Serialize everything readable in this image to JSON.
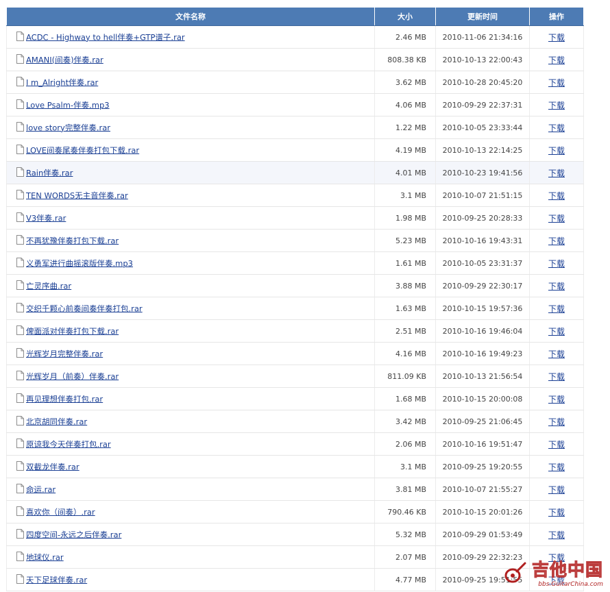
{
  "header": {
    "name": "文件名称",
    "size": "大小",
    "time": "更新时间",
    "op": "操作"
  },
  "download_label": "下载",
  "highlight_row": 6,
  "files": [
    {
      "name": "ACDC - Highway to hell伴奏+GTP谱子.rar",
      "size": "2.46 MB",
      "time": "2010-11-06 21:34:16"
    },
    {
      "name": "AMANI(间奏)伴奏.rar",
      "size": "808.38 KB",
      "time": "2010-10-13 22:00:43"
    },
    {
      "name": "I m_Alright伴奏.rar",
      "size": "3.62 MB",
      "time": "2010-10-28 20:45:20"
    },
    {
      "name": "Love Psalm-伴奏.mp3",
      "size": "4.06 MB",
      "time": "2010-09-29 22:37:31"
    },
    {
      "name": "love story完整伴奏.rar",
      "size": "1.22 MB",
      "time": "2010-10-05 23:33:44"
    },
    {
      "name": "LOVE间奏尾奏伴奏打包下载.rar",
      "size": "4.19 MB",
      "time": "2010-10-13 22:14:25"
    },
    {
      "name": "Rain伴奏.rar",
      "size": "4.01 MB",
      "time": "2010-10-23 19:41:56"
    },
    {
      "name": "TEN WORDS无主音伴奏.rar",
      "size": "3.1 MB",
      "time": "2010-10-07 21:51:15"
    },
    {
      "name": "V3伴奏.rar",
      "size": "1.98 MB",
      "time": "2010-09-25 20:28:33"
    },
    {
      "name": "不再犹豫伴奏打包下载.rar",
      "size": "5.23 MB",
      "time": "2010-10-16 19:43:31"
    },
    {
      "name": "义勇军进行曲摇滚版伴奏.mp3",
      "size": "1.61 MB",
      "time": "2010-10-05 23:31:37"
    },
    {
      "name": "亡灵序曲.rar",
      "size": "3.88 MB",
      "time": "2010-09-29 22:30:17"
    },
    {
      "name": "交织千颗心前奏间奏伴奏打包.rar",
      "size": "1.63 MB",
      "time": "2010-10-15 19:57:36"
    },
    {
      "name": "俾面派对伴奏打包下载.rar",
      "size": "2.51 MB",
      "time": "2010-10-16 19:46:04"
    },
    {
      "name": "光辉岁月完整伴奏.rar",
      "size": "4.16 MB",
      "time": "2010-10-16 19:49:23"
    },
    {
      "name": "光辉岁月（前奏）伴奏.rar",
      "size": "811.09 KB",
      "time": "2010-10-13 21:56:54"
    },
    {
      "name": "再见理想伴奏打包.rar",
      "size": "1.68 MB",
      "time": "2010-10-15 20:00:08"
    },
    {
      "name": "北京胡同伴奏.rar",
      "size": "3.42 MB",
      "time": "2010-09-25 21:06:45"
    },
    {
      "name": "原谅我今天伴奏打包.rar",
      "size": "2.06 MB",
      "time": "2010-10-16 19:51:47"
    },
    {
      "name": "双截龙伴奏.rar",
      "size": "3.1 MB",
      "time": "2010-09-25 19:20:55"
    },
    {
      "name": "命运.rar",
      "size": "3.81 MB",
      "time": "2010-10-07 21:55:27"
    },
    {
      "name": "喜欢你（间奏）.rar",
      "size": "790.46 KB",
      "time": "2010-10-15 20:01:26"
    },
    {
      "name": "四度空间-永远之后伴奏.rar",
      "size": "5.32 MB",
      "time": "2010-09-29 01:53:49"
    },
    {
      "name": "地球仪.rar",
      "size": "2.07 MB",
      "time": "2010-09-29 22:32:23"
    },
    {
      "name": "天下足球伴奏.rar",
      "size": "4.77 MB",
      "time": "2010-09-25 19:51:55"
    }
  ],
  "watermark": {
    "title": "吉他中国",
    "url": "bbs.GuitarChina.com"
  },
  "colors": {
    "header_bg": "#4d7bb4",
    "link": "#1a3f94",
    "watermark": "#b02020"
  },
  "icons": {
    "file": "file-icon"
  }
}
